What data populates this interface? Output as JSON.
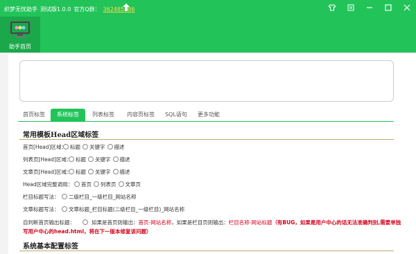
{
  "titlebar": {
    "app_name": "织梦无忧助手",
    "version": "测试版1.0.0",
    "qq_label": "官方Q群：",
    "qq_number": "362485386"
  },
  "nav": {
    "home_label": "助手首页"
  },
  "tabs": [
    {
      "label": "首页标签"
    },
    {
      "label": "系统标签"
    },
    {
      "label": "列表标签"
    },
    {
      "label": "内容页标签"
    },
    {
      "label": "SQL语句"
    },
    {
      "label": "更多功能"
    }
  ],
  "section1_title": "常用模板Head区域标签",
  "rows": {
    "home_head": {
      "label": "首页[Head]区域：",
      "opts": [
        "标题",
        "关键字",
        "描述"
      ]
    },
    "list_head": {
      "label": "列表页[Head]区域：",
      "opts": [
        "标题",
        "关键字",
        "描述"
      ]
    },
    "article_head": {
      "label": "文章页[Head]区域：",
      "opts": [
        "标题",
        "关键字",
        "描述"
      ]
    },
    "head_call": {
      "label": "Head区域完整调用：",
      "opts": [
        "首页",
        "列表页",
        "文章页"
      ]
    },
    "col_title": {
      "label": "栏目标题写法：",
      "opts": [
        "二级栏目_一级栏目_网站名称"
      ]
    },
    "art_title": {
      "label": "文章标题写法：",
      "opts": [
        "文章标题_栏目标题(二级栏目_一级栏目)_网站名称"
      ]
    }
  },
  "auto_judge": {
    "label": "自判断首页输出标题：",
    "text1": "如果是首页则输出：",
    "value1": "首页-网站名称",
    "text2": "，如果是栏目页则输出：",
    "value2": "栏目名称-网站标题",
    "warn1": "（有BUG，如果是用户中心的话无法准确判别,需要单独",
    "warn2": "写用户中心的head.html，将在下一版本修复该问题）"
  },
  "section2_title": "系统基本配置标签"
}
